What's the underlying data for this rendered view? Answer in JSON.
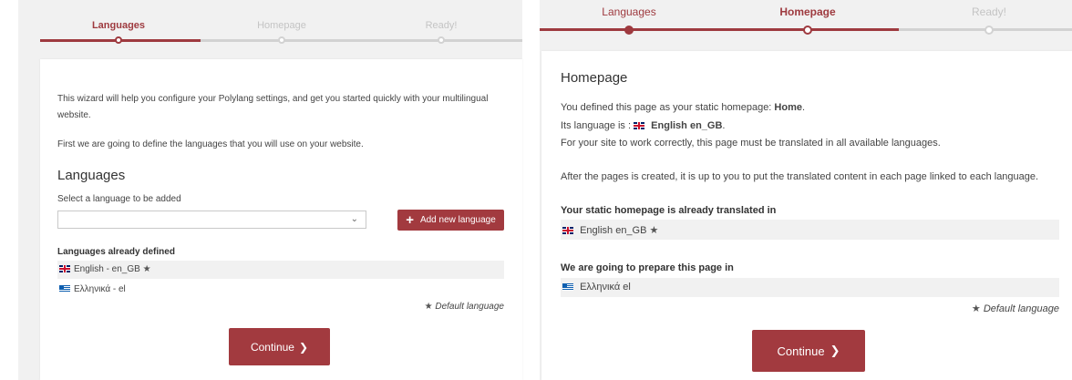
{
  "steps": [
    "Languages",
    "Homepage",
    "Ready!"
  ],
  "left": {
    "intro_line1": "This wizard will help you configure your Polylang settings, and get you started quickly with your multilingual",
    "intro_line2": "website.",
    "intro_line3": "First we are going to define the languages that you will use on your website.",
    "heading": "Languages",
    "select_label": "Select a language to be added",
    "select_value": "",
    "add_button": "Add new language",
    "defined_heading": "Languages already defined",
    "languages": [
      {
        "name": "English - en_GB",
        "flag": "uk",
        "default": true
      },
      {
        "name": "Ελληνικά - el",
        "flag": "gr",
        "default": false
      }
    ],
    "default_note": "Default language",
    "continue": "Continue"
  },
  "right": {
    "heading": "Homepage",
    "line1_prefix": "You defined this page as your static homepage: ",
    "line1_value": "Home",
    "line1_suffix": ".",
    "line2_prefix": "Its language is : ",
    "line2_value": "English en_GB",
    "line2_suffix": ".",
    "line3": "For your site to work correctly, this page must be translated in all available languages.",
    "line4": "After the pages is created, it is up to you to put the translated content in each page linked to each language.",
    "translated_heading": "Your static homepage is already translated in",
    "translated_lang": "English en_GB",
    "prepare_heading": "We are going to prepare this page in",
    "prepare_lang": "Ελληνικά el",
    "default_note": "Default language",
    "continue": "Continue"
  },
  "colors": {
    "accent": "#a23a3f",
    "panel_bg": "#f1f1f1"
  }
}
